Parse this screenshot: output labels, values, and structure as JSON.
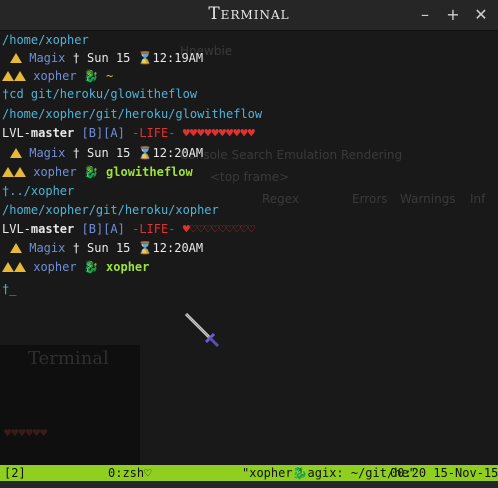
{
  "window": {
    "title": "Terminal"
  },
  "titlebar": {
    "minimize": "–",
    "maximize": "+",
    "close": "✕"
  },
  "ghost": {
    "items": [
      "Hnewbie",
      "Console  Search  Emulation  Rendering",
      "<top frame>",
      "Regex",
      "Errors",
      "Warnings",
      "Inf"
    ],
    "title": "Terminal",
    "hearts": "♥♥♥♥♥♥"
  },
  "lines": {
    "l1": {
      "path": "/home/xopher"
    },
    "l2": {
      "user": "Magix",
      "date": "† Sun 15 ⌛12:19AM"
    },
    "l3": {
      "user": "xopher",
      "icon": "🐉",
      "prompt": "~"
    },
    "l4": {
      "cmd": "†cd git/heroku/glowitheflow"
    },
    "l5": {
      "path": "/home/xopher/git/heroku/glowitheflow"
    },
    "l6": {
      "lvl": "LVL-",
      "branch": "master",
      "flags": "[B][A]",
      "life": "-LIFE-",
      "hearts": "♥♥♥♥♥♥♥♥♥♥"
    },
    "l7": {
      "user": "Magix",
      "date": "† Sun 15 ⌛12:20AM"
    },
    "l8": {
      "user": "xopher",
      "icon": "🐉",
      "prompt": "glowitheflow"
    },
    "l9": {
      "cmd": "†../xopher"
    },
    "l10": {
      "path": "/home/xopher/git/heroku/xopher"
    },
    "l11": {
      "lvl": "LVL-",
      "branch": "master",
      "flags": "[B][A]",
      "life": "-LIFE-",
      "hearts_full": "♥",
      "hearts_empty": "♡♡♡♡♡♡♡♡♡"
    },
    "l12": {
      "user": "Magix",
      "date": "† Sun 15 ⌛12:20AM"
    },
    "l13": {
      "user": "xopher",
      "icon": "🐉",
      "prompt": "xopher"
    },
    "l14": {
      "cursor": "†_"
    }
  },
  "status": {
    "window_num": "[2]",
    "session": "0:zsh♡",
    "host": "\"xopher🐉agix: ~/git/he\"",
    "time": "00:20 15-Nov-15"
  }
}
